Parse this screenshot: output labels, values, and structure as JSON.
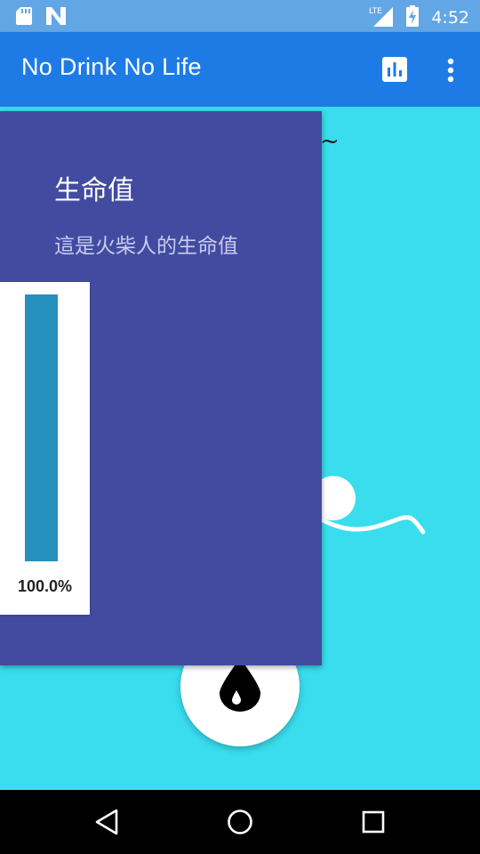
{
  "status_bar": {
    "time": "4:52",
    "network": "LTE",
    "icons": [
      "sd-card-icon",
      "n-notification-icon",
      "lte-signal-icon",
      "battery-charging-icon"
    ]
  },
  "app_bar": {
    "title": "No Drink No Life",
    "actions": [
      "chart-icon",
      "more-vert-icon"
    ]
  },
  "content": {
    "tilde_text": "~",
    "fab_icon": "water-drop-icon"
  },
  "tooltip_panel": {
    "title": "生命值",
    "subtitle": "這是火柴人的生命值"
  },
  "health_meter": {
    "value": 1.0,
    "label": "100.0%",
    "fill_color": "#2590BE"
  },
  "nav_bar": {
    "buttons": [
      "back-icon",
      "home-icon",
      "recents-icon"
    ]
  },
  "colors": {
    "status_bar": "#62A6E6",
    "app_bar": "#1E7BE6",
    "background": "#39DDEE",
    "panel": "#434BA0"
  }
}
